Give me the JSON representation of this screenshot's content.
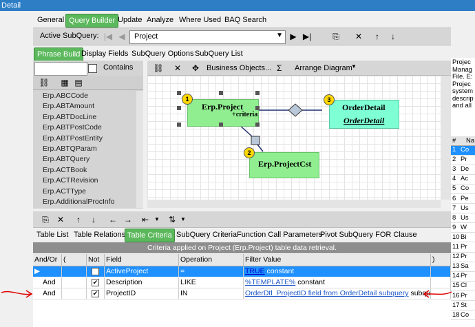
{
  "window": {
    "title": "Detail"
  },
  "menu": {
    "items": [
      "General",
      "Query Builder",
      "Update",
      "Analyze",
      "Where Used",
      "BAQ Search"
    ]
  },
  "subquery": {
    "label": "Active SubQuery:",
    "value": "Project"
  },
  "subtabs": [
    "Phrase Build",
    "Display Fields",
    "SubQuery Options",
    "SubQuery List"
  ],
  "leftpane": {
    "contains_label": "Contains",
    "tables": [
      "Erp.ABCCode",
      "Erp.ABTAmount",
      "Erp.ABTDocLine",
      "Erp.ABTPostCode",
      "Erp.ABTPostEntity",
      "Erp.ABTQParam",
      "Erp.ABTQuery",
      "Erp.ACTBook",
      "Erp.ACTRevision",
      "Erp.ACTType",
      "Erp.AdditionalProcInfo"
    ]
  },
  "diagram_toolbar": {
    "business_objects": "Business Objects...",
    "sigma": "Σ",
    "arrange": "Arrange Diagram"
  },
  "diagram": {
    "nodes": [
      {
        "badge": "1",
        "title": "Erp.Project",
        "sub": "+criteria"
      },
      {
        "badge": "2",
        "title": "Erp.ProjectCst",
        "sub": ""
      },
      {
        "badge": "3",
        "title": "OrderDetail",
        "sub": "OrderDetail"
      }
    ]
  },
  "rightpane": {
    "text_lines": [
      "Projec",
      "Manag",
      "File. E:",
      "Projec",
      "system",
      "descrip",
      "and all"
    ],
    "header": [
      "#",
      "Na"
    ],
    "rows": [
      {
        "n": "1",
        "v": "Co"
      },
      {
        "n": "2",
        "v": "Pr"
      },
      {
        "n": "3",
        "v": "De"
      },
      {
        "n": "4",
        "v": "Ac"
      },
      {
        "n": "5",
        "v": "Co"
      },
      {
        "n": "6",
        "v": "Pe"
      },
      {
        "n": "7",
        "v": "Us"
      },
      {
        "n": "8",
        "v": "Us"
      },
      {
        "n": "9",
        "v": "W"
      },
      {
        "n": "10",
        "v": "Bi"
      },
      {
        "n": "11",
        "v": "Pr"
      },
      {
        "n": "12",
        "v": "Pr"
      },
      {
        "n": "13",
        "v": "Sa"
      },
      {
        "n": "14",
        "v": "Pr"
      },
      {
        "n": "15",
        "v": "Cl"
      },
      {
        "n": "16",
        "v": "Pr"
      },
      {
        "n": "17",
        "v": "St"
      },
      {
        "n": "18",
        "v": "Co"
      }
    ]
  },
  "bottom_tabs": [
    "Table List",
    "Table Relations",
    "Table Criteria",
    "SubQuery Criteria",
    "Function Call Parameters",
    "Pivot SubQuery FOR Clause"
  ],
  "criteria": {
    "caption": "Criteria applied on Project (Erp.Project)  table data retrieval.",
    "columns": [
      "And/Or",
      "(",
      "Not",
      "Field",
      "Operation",
      "Filter Value",
      ")"
    ],
    "rows": [
      {
        "andor": "",
        "not": false,
        "field": "ActiveProject",
        "op": "=",
        "link": "TRUE",
        "text": "constant"
      },
      {
        "andor": "And",
        "not": true,
        "field": "Description",
        "op": "LIKE",
        "link": "%TEMPLATE%",
        "text": "constant"
      },
      {
        "andor": "And",
        "not": true,
        "field": "ProjectID",
        "op": "IN",
        "link": "OrderDtl_ProjectID field from OrderDetail subquery",
        "text": "subquer"
      }
    ]
  },
  "colors": {
    "accent_green": "#5cb85c",
    "selection_blue": "#1e90ff",
    "title_blue": "#2e7ec6",
    "node_green": "#90ee90",
    "annotation_red": "#e00000"
  }
}
